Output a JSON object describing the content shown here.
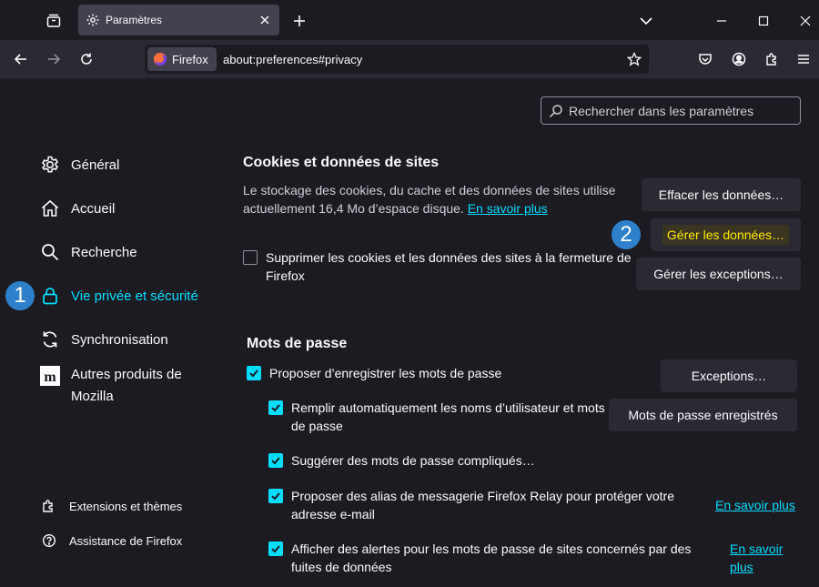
{
  "tabs": [
    {
      "title": "Paramètres"
    }
  ],
  "address": {
    "identity_label": "Firefox",
    "url": "about:preferences#privacy"
  },
  "search": {
    "placeholder": "Rechercher dans les paramètres"
  },
  "sidebar": {
    "items": [
      {
        "label": "Général",
        "icon": "gear-icon"
      },
      {
        "label": "Accueil",
        "icon": "home-icon"
      },
      {
        "label": "Recherche",
        "icon": "search-icon"
      },
      {
        "label": "Vie privée et sécurité",
        "icon": "lock-icon",
        "selected": true
      },
      {
        "label": "Synchronisation",
        "icon": "sync-icon"
      },
      {
        "label": "Autres produits de Mozilla",
        "icon": "mozilla-icon"
      }
    ],
    "footer": [
      {
        "label": "Extensions et thèmes",
        "icon": "puzzle-icon"
      },
      {
        "label": "Assistance de Firefox",
        "icon": "help-icon"
      }
    ]
  },
  "badges": [
    "1",
    "2"
  ],
  "cookies": {
    "title": "Cookies et données de sites",
    "desc": "Le stockage des cookies, du cache et des données de sites utilise actuellement 16,4 Mo d’espace disque.",
    "learn_more": "En savoir plus",
    "clear_btn": "Effacer les données…",
    "manage_btn": "Gérer les données…",
    "exceptions_btn": "Gérer les exceptions…",
    "delete_on_close": {
      "label": "Supprimer les cookies et les données des sites à la fermeture de Firefox",
      "checked": false
    }
  },
  "passwords": {
    "title": "Mots de passe",
    "offer_save": {
      "label": "Proposer d’enregistrer les mots de passe",
      "checked": true
    },
    "exceptions_btn": "Exceptions…",
    "autofill": {
      "label": "Remplir automatiquement les noms d’utilisateur et mots de passe",
      "checked": true
    },
    "saved_btn": "Mots de passe enregistrés",
    "suggest": {
      "label": "Suggérer des mots de passe compliqués…",
      "checked": true
    },
    "relay": {
      "label": "Proposer des alias de messagerie Firefox Relay pour protéger votre adresse e-mail",
      "checked": true,
      "link": "En savoir plus"
    },
    "breach": {
      "label": "Afficher des alertes pour les mots de passe de sites concernés par des fuites de données",
      "checked": true,
      "link": "En savoir plus"
    }
  },
  "colors": {
    "accent": "#00ddff",
    "badge": "#2d80c9",
    "highlight": "#ffe900"
  }
}
